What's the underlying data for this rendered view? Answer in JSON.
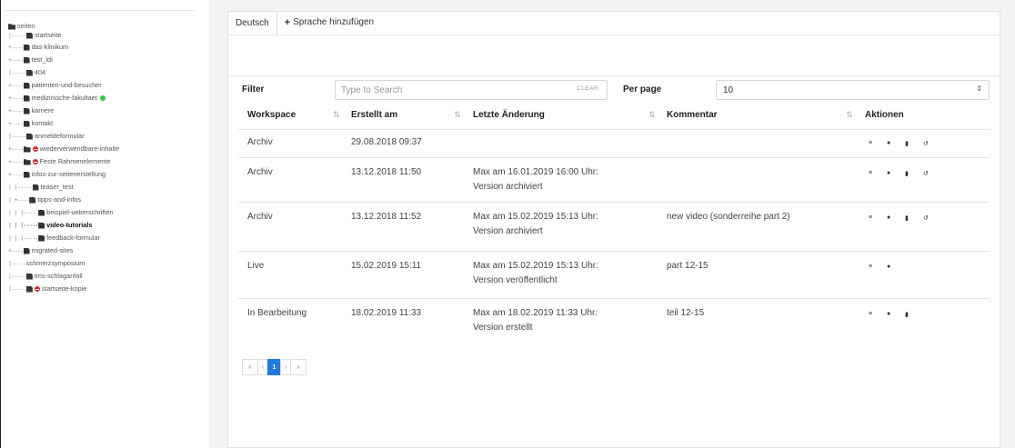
{
  "tree": [
    {
      "prefix": "",
      "label": "seiten",
      "icon": "folder",
      "top": 0
    },
    {
      "prefix": "|-----",
      "label": "startseite",
      "icon": "doc"
    },
    {
      "prefix": "+----",
      "label": "das-klinikum",
      "icon": "doc"
    },
    {
      "prefix": "+----",
      "label": "test_ldi",
      "icon": "doc"
    },
    {
      "prefix": "|-----",
      "label": "404",
      "icon": "doc"
    },
    {
      "prefix": "+----",
      "label": "patienten-und-besucher",
      "icon": "doc"
    },
    {
      "prefix": "+----",
      "label": "medizinische-fakultaet",
      "icon": "doc",
      "green": true
    },
    {
      "prefix": "+----",
      "label": "karriere",
      "icon": "doc"
    },
    {
      "prefix": "+----",
      "label": "kontakt",
      "icon": "doc"
    },
    {
      "prefix": "|-----",
      "label": "anmeldeformular",
      "icon": "doc"
    },
    {
      "prefix": "+----",
      "label": "wiederverwendbare-inhalte",
      "icon": "folder",
      "red": true
    },
    {
      "prefix": "+----",
      "label": "Feste Rahmenelemente",
      "icon": "folder",
      "red": true
    },
    {
      "prefix": "+----",
      "label": "infos-zur-seitenerstellung",
      "icon": "doc"
    },
    {
      "prefix": "|   |-----",
      "label": "teaser_test",
      "icon": "doc"
    },
    {
      "prefix": "|   +----",
      "label": "tipps-and-infos",
      "icon": "doc"
    },
    {
      "prefix": "|   |   |-----",
      "label": "beispiel-ueberschriften",
      "icon": "doc"
    },
    {
      "prefix": "|   |   |-----",
      "label": "video-tutorials",
      "icon": "doc",
      "bold": true
    },
    {
      "prefix": "|   |   |-----",
      "label": "feedback-formular",
      "icon": "doc"
    },
    {
      "prefix": "+----",
      "label": "migrated-sites",
      "icon": "doc"
    },
    {
      "prefix": "|-----",
      "label": "schmerzsymposium",
      "icon": "none"
    },
    {
      "prefix": "|-----",
      "label": "tms-schlaganfall",
      "icon": "doc"
    },
    {
      "prefix": "|-----",
      "label": "startseite-kopie",
      "icon": "doc",
      "red": true
    }
  ],
  "tabs": {
    "active": "Deutsch",
    "add": "Sprache hinzufügen"
  },
  "filter": {
    "label": "Filter",
    "placeholder": "Type to Search",
    "clear": "CLEAR",
    "perpage_label": "Per page",
    "perpage_value": "10"
  },
  "table": {
    "headers": [
      "Workspace",
      "Erstellt am",
      "Letzte Änderung",
      "Kommentar",
      "Aktionen"
    ],
    "rows": [
      {
        "workspace": "Archiv",
        "created": "29.08.2018 09:37",
        "change1": "",
        "change2": "",
        "comment": "",
        "actions": [
          "list",
          "eye",
          "trash",
          "undo"
        ]
      },
      {
        "workspace": "Archiv",
        "created": "13.12.2018 11:50",
        "change1": "Max am 16.01.2019 16:00 Uhr:",
        "change2": "Version archiviert",
        "comment": "",
        "actions": [
          "list",
          "eye",
          "trash",
          "undo"
        ]
      },
      {
        "workspace": "Archiv",
        "created": "13.12.2018 11:52",
        "change1": "Max am 15.02.2019 15:13 Uhr:",
        "change2": "Version archiviert",
        "comment": "new video (sonderreihe part 2)",
        "actions": [
          "list",
          "eye",
          "trash",
          "undo"
        ]
      },
      {
        "workspace": "Live",
        "created": "15.02.2019 15:11",
        "change1": "Max am 15.02.2019 15:13 Uhr:",
        "change2": "Version veröffentlicht",
        "comment": "part 12-15",
        "actions": [
          "list",
          "eye"
        ]
      },
      {
        "workspace": "In Bearbeitung",
        "created": "18.02.2019 11:33",
        "change1": "Max am 18.02.2019 11:33 Uhr:",
        "change2": "Version erstellt",
        "comment": "teil 12-15",
        "actions": [
          "list",
          "eye",
          "trash"
        ]
      }
    ]
  },
  "pager": {
    "first": "«",
    "prev": "‹",
    "current": "1",
    "next": "›",
    "last": "»"
  }
}
